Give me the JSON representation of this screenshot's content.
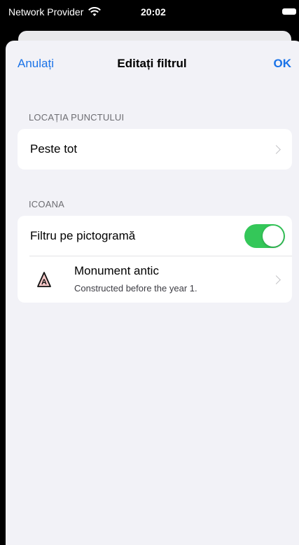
{
  "status_bar": {
    "carrier": "Network Provider",
    "time": "20:02"
  },
  "nav": {
    "cancel_label": "Anulați",
    "title": "Editați filtrul",
    "ok_label": "OK"
  },
  "sections": {
    "location": {
      "header": "LOCAȚIA PUNCTULUI",
      "value": "Peste tot"
    },
    "icon": {
      "header": "ICOANA",
      "toggle_label": "Filtru pe pictogramă",
      "toggle_on": true,
      "item": {
        "title": "Monument antic",
        "subtitle": "Constructed before the year 1.",
        "icon": "monument-antic-icon",
        "icon_letter": "A"
      }
    }
  },
  "colors": {
    "accent": "#1a73e8",
    "toggle_on": "#34c759",
    "icon_fill": "#f6c7c7"
  }
}
